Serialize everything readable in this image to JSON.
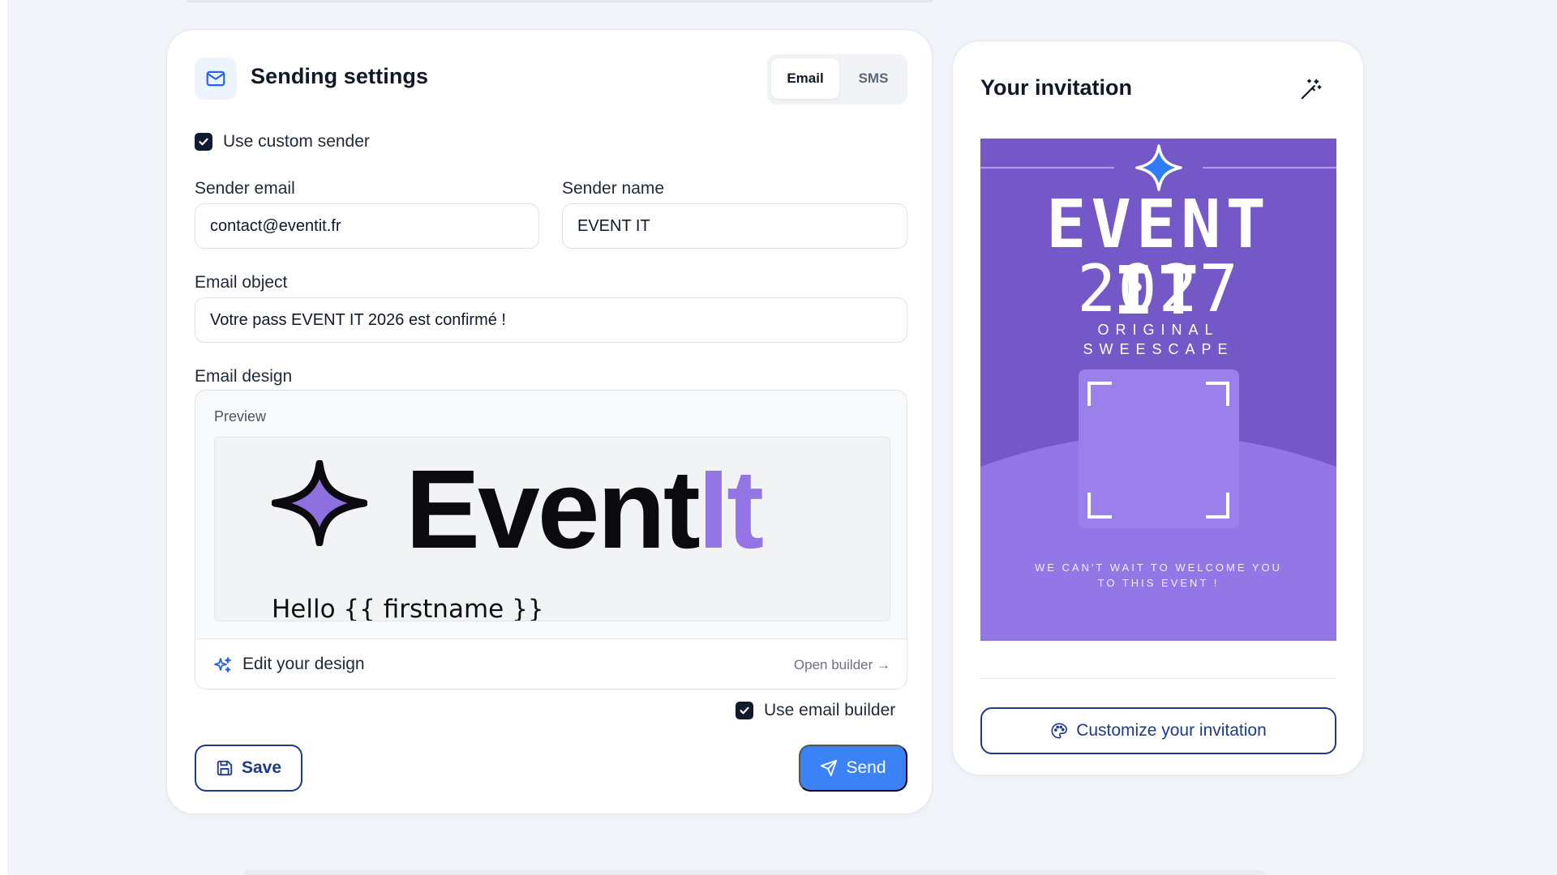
{
  "settings": {
    "title": "Sending settings",
    "channel_tabs": [
      {
        "label": "Email",
        "selected": true
      },
      {
        "label": "SMS",
        "selected": false
      }
    ],
    "use_custom_sender": {
      "label": "Use custom sender",
      "checked": true
    },
    "sender_email": {
      "label": "Sender email",
      "value": "contact@eventit.fr"
    },
    "sender_name": {
      "label": "Sender name",
      "value": "EVENT IT"
    },
    "email_object": {
      "label": "Email object",
      "value": "Votre pass EVENT IT 2026 est confirmé !"
    },
    "email_design": {
      "label": "Email design",
      "preview_label": "Preview",
      "logo_text_dark": "Event",
      "logo_text_accent": "It",
      "greeting": "Hello {{ firstname }}",
      "edit_label": "Edit your design",
      "open_builder_label": "Open builder →"
    },
    "use_email_builder": {
      "label": "Use email builder",
      "checked": true
    },
    "save_label": "Save",
    "send_label": "Send"
  },
  "invitation": {
    "title": "Your invitation",
    "art": {
      "headline": "EVENT IT",
      "year": "2027",
      "subtitle_line1": "ORIGINAL",
      "subtitle_line2": "SWEESCAPE",
      "message_line1": "WE CAN'T WAIT TO WELCOME YOU",
      "message_line2": "TO THIS EVENT !"
    },
    "customize_label": "Customize your invitation"
  },
  "colors": {
    "accent_blue": "#3b82f6",
    "navy": "#1e3a8a",
    "brand_purple": "#9575e6",
    "invite_purple_dark": "#7558c8",
    "invite_purple_light": "#9477e6"
  }
}
